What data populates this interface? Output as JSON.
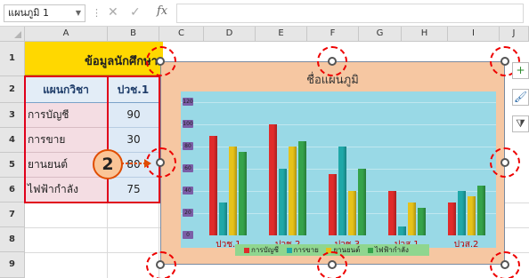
{
  "formula_bar": {
    "name_box": "แผนภูมิ 1",
    "fx_label": "fx",
    "formula_value": ""
  },
  "columns": [
    "A",
    "B",
    "C",
    "D",
    "E",
    "F",
    "G",
    "H",
    "I",
    "J"
  ],
  "rows": [
    "1",
    "2",
    "3",
    "4",
    "5",
    "6",
    "7",
    "8",
    "9"
  ],
  "table": {
    "title": "ข้อมูลนักศึกษา",
    "header_subject": "แผนกวิชา",
    "header_level": "ปวช.1",
    "subjects": [
      "การบัญชี",
      "การขาย",
      "ยานยนต์",
      "ไฟฟ้ากำลัง"
    ],
    "values": [
      "90",
      "30",
      "80",
      "75"
    ]
  },
  "callout": {
    "number": "2"
  },
  "chart_data": {
    "type": "bar",
    "title": "ชื่อแผนภูมิ",
    "categories": [
      "ปวช.1",
      "ปวช.2",
      "ปวช.3",
      "ปวส.1",
      "ปวส.2"
    ],
    "series": [
      {
        "name": "การบัญชี",
        "color": "#e02b2b",
        "values": [
          90,
          100,
          55,
          40,
          30
        ]
      },
      {
        "name": "การขาย",
        "color": "#1fa8a8",
        "values": [
          30,
          60,
          80,
          8,
          40
        ]
      },
      {
        "name": "ยานยนต์",
        "color": "#e6c21a",
        "values": [
          80,
          80,
          40,
          30,
          35
        ]
      },
      {
        "name": "ไฟฟ้ากำลัง",
        "color": "#35a34a",
        "values": [
          75,
          85,
          60,
          25,
          45
        ]
      }
    ],
    "legend_labels": [
      "การบัญชี",
      "การขาย",
      "ยานยนต์",
      "ไฟฟ้ากำลัง"
    ],
    "ylim": [
      0,
      120
    ],
    "grid": true,
    "legend_position": "bottom"
  },
  "side_buttons": {
    "add": "+",
    "brush": "🖌",
    "filter": "⧩"
  },
  "colors": {
    "title_fill": "#ffd800",
    "chart_area": "#f6c7a2",
    "plot_area": "#99d9e6",
    "selection": "#e0001a"
  }
}
